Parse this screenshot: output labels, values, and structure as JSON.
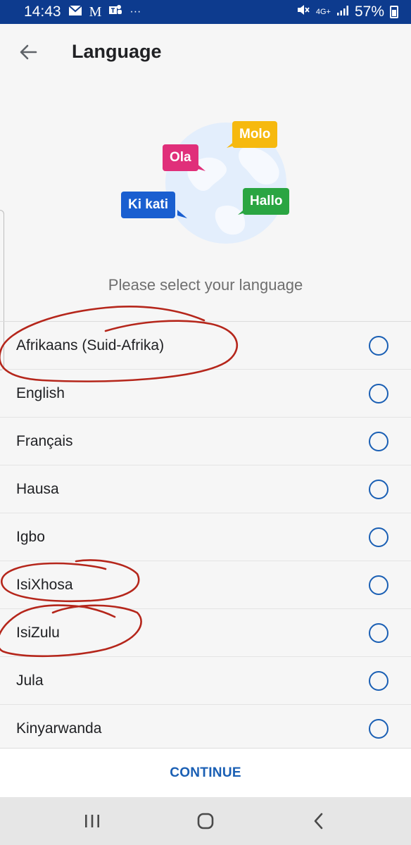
{
  "status_bar": {
    "time": "14:43",
    "dots": "···",
    "network": "4G+",
    "battery": "57%"
  },
  "header": {
    "title": "Language",
    "back_icon": "arrow-left-icon"
  },
  "illustration": {
    "bubbles": [
      {
        "text": "Molo",
        "color": "#f6b90f"
      },
      {
        "text": "Ola",
        "color": "#e02f7a"
      },
      {
        "text": "Ki kati",
        "color": "#1a5fd0"
      },
      {
        "text": "Hallo",
        "color": "#2aa542"
      }
    ],
    "globe_color": "#e3eefc"
  },
  "subtitle": "Please select your language",
  "languages": [
    {
      "label": "Afrikaans (Suid-Afrika)",
      "selected": false
    },
    {
      "label": "English",
      "selected": false
    },
    {
      "label": "Français",
      "selected": false
    },
    {
      "label": "Hausa",
      "selected": false
    },
    {
      "label": "Igbo",
      "selected": false
    },
    {
      "label": "IsiXhosa",
      "selected": false
    },
    {
      "label": "IsiZulu",
      "selected": false
    },
    {
      "label": "Jula",
      "selected": false
    },
    {
      "label": "Kinyarwanda",
      "selected": false
    }
  ],
  "footer": {
    "continue_label": "CONTINUE"
  },
  "nav_bar": {
    "recents_icon": "recents-icon",
    "home_icon": "home-icon",
    "back_icon": "back-chevron-icon"
  },
  "colors": {
    "status_bar": "#0d3b8e",
    "accent": "#1a5fb4",
    "annotation": "#b5261b"
  }
}
